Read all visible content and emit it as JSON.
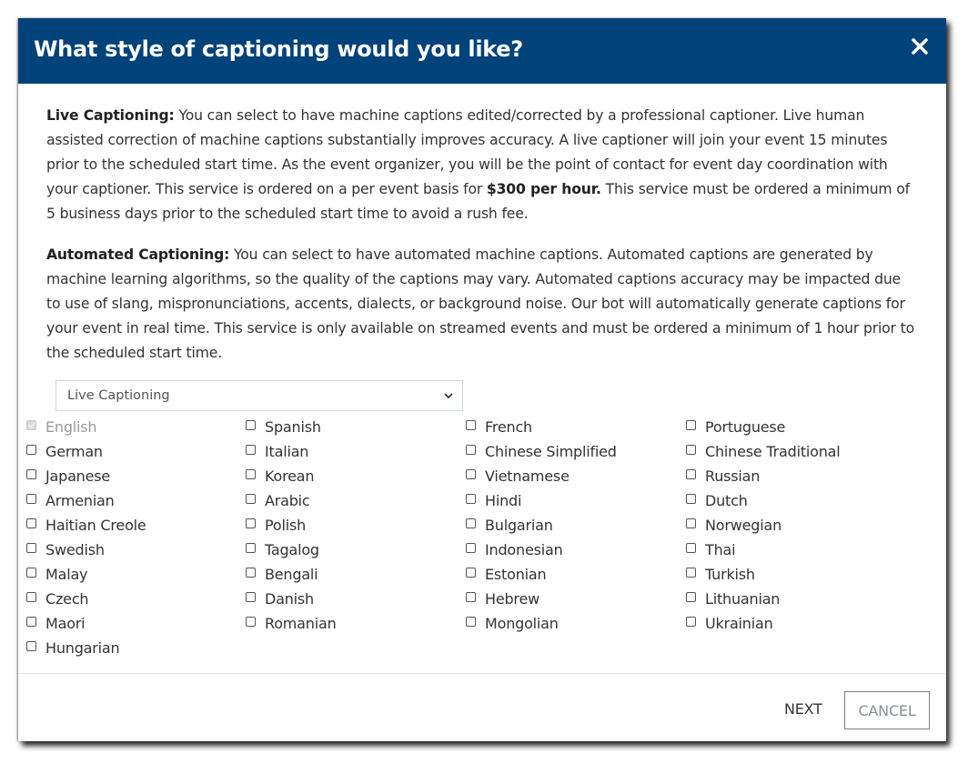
{
  "dialog": {
    "title": "What style of captioning would you like?",
    "close_icon": "close-icon",
    "header_color": "#00427a"
  },
  "descriptions": {
    "live": {
      "label": "Live Captioning:",
      "text_before": " You can select to have machine captions edited/corrected by a professional captioner. Live human assisted correction of machine captions substantially improves accuracy. A live captioner will join your event 15 minutes prior to the scheduled start time. As the event organizer, you will be the point of contact for event day coordination with your captioner. This service is ordered on a per event basis for ",
      "price": "$300 per hour.",
      "text_after": " This service must be ordered a minimum of 5 business days prior to the scheduled start time to avoid a rush fee."
    },
    "automated": {
      "label": "Automated Captioning:",
      "text": " You can select to have automated machine captions. Automated captions are generated by machine learning algorithms, so the quality of the captions may vary. Automated captions accuracy may be impacted due to use of slang, mispronunciations, accents, dialects, or background noise. Our bot will automatically generate captions for your event in real time. This service is only available on streamed events and must be ordered a minimum of 1 hour prior to the scheduled start time."
    }
  },
  "captioning_select": {
    "selected": "Live Captioning"
  },
  "languages": [
    {
      "label": "English",
      "checked": true,
      "disabled": true
    },
    {
      "label": "Spanish",
      "checked": false,
      "disabled": false
    },
    {
      "label": "French",
      "checked": false,
      "disabled": false
    },
    {
      "label": "Portuguese",
      "checked": false,
      "disabled": false
    },
    {
      "label": "German",
      "checked": false,
      "disabled": false
    },
    {
      "label": "Italian",
      "checked": false,
      "disabled": false
    },
    {
      "label": "Chinese Simplified",
      "checked": false,
      "disabled": false
    },
    {
      "label": "Chinese Traditional",
      "checked": false,
      "disabled": false
    },
    {
      "label": "Japanese",
      "checked": false,
      "disabled": false
    },
    {
      "label": "Korean",
      "checked": false,
      "disabled": false
    },
    {
      "label": "Vietnamese",
      "checked": false,
      "disabled": false
    },
    {
      "label": "Russian",
      "checked": false,
      "disabled": false
    },
    {
      "label": "Armenian",
      "checked": false,
      "disabled": false
    },
    {
      "label": "Arabic",
      "checked": false,
      "disabled": false
    },
    {
      "label": "Hindi",
      "checked": false,
      "disabled": false
    },
    {
      "label": "Dutch",
      "checked": false,
      "disabled": false
    },
    {
      "label": "Haitian Creole",
      "checked": false,
      "disabled": false
    },
    {
      "label": "Polish",
      "checked": false,
      "disabled": false
    },
    {
      "label": "Bulgarian",
      "checked": false,
      "disabled": false
    },
    {
      "label": "Norwegian",
      "checked": false,
      "disabled": false
    },
    {
      "label": "Swedish",
      "checked": false,
      "disabled": false
    },
    {
      "label": "Tagalog",
      "checked": false,
      "disabled": false
    },
    {
      "label": "Indonesian",
      "checked": false,
      "disabled": false
    },
    {
      "label": "Thai",
      "checked": false,
      "disabled": false
    },
    {
      "label": "Malay",
      "checked": false,
      "disabled": false
    },
    {
      "label": "Bengali",
      "checked": false,
      "disabled": false
    },
    {
      "label": "Estonian",
      "checked": false,
      "disabled": false
    },
    {
      "label": "Turkish",
      "checked": false,
      "disabled": false
    },
    {
      "label": "Czech",
      "checked": false,
      "disabled": false
    },
    {
      "label": "Danish",
      "checked": false,
      "disabled": false
    },
    {
      "label": "Hebrew",
      "checked": false,
      "disabled": false
    },
    {
      "label": "Lithuanian",
      "checked": false,
      "disabled": false
    },
    {
      "label": "Maori",
      "checked": false,
      "disabled": false
    },
    {
      "label": "Romanian",
      "checked": false,
      "disabled": false
    },
    {
      "label": "Mongolian",
      "checked": false,
      "disabled": false
    },
    {
      "label": "Ukrainian",
      "checked": false,
      "disabled": false
    },
    {
      "label": "Hungarian",
      "checked": false,
      "disabled": false
    }
  ],
  "footer": {
    "next_label": "NEXT",
    "cancel_label": "CANCEL"
  }
}
